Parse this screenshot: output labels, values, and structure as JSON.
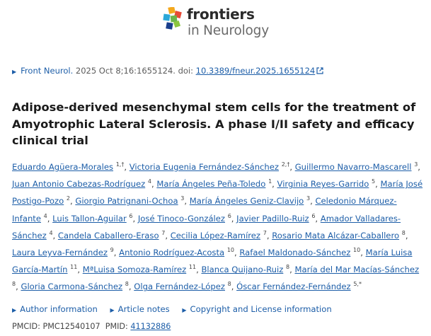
{
  "journal": {
    "brand": "frontiers",
    "name": "in Neurology"
  },
  "citation": {
    "journal_abbrev": "Front Neurol.",
    "details": " 2025 Oct 8;16:1655124. doi: ",
    "doi": "10.3389/fneur.2025.1655124"
  },
  "title": "Adipose-derived mesenchymal stem cells for the treatment of Amyotrophic Lateral Sclerosis. A phase I/II safety and efficacy clinical trial",
  "authors": [
    {
      "name": "Eduardo Agüera-Morales",
      "sup": "1,†"
    },
    {
      "name": "Victoria Eugenia Fernández-Sánchez",
      "sup": "2,†"
    },
    {
      "name": "Guillermo Navarro-Mascarell",
      "sup": "3"
    },
    {
      "name": "Juan Antonio Cabezas-Rodríguez",
      "sup": "4"
    },
    {
      "name": "María Ángeles Peña-Toledo",
      "sup": "1"
    },
    {
      "name": "Virginia Reyes-Garrido",
      "sup": "5"
    },
    {
      "name": "María José Postigo-Pozo",
      "sup": "2"
    },
    {
      "name": "Giorgio Patrignani-Ochoa",
      "sup": "3"
    },
    {
      "name": "María Ángeles Geniz-Clavijo",
      "sup": "3"
    },
    {
      "name": "Celedonio Márquez-Infante",
      "sup": "4"
    },
    {
      "name": "Luis Tallon-Aguilar",
      "sup": "6"
    },
    {
      "name": "José Tinoco-González",
      "sup": "6"
    },
    {
      "name": "Javier Padillo-Ruiz",
      "sup": "6"
    },
    {
      "name": "Amador Valladares-Sánchez",
      "sup": "4"
    },
    {
      "name": "Candela Caballero-Eraso",
      "sup": "7"
    },
    {
      "name": "Cecilia López-Ramírez",
      "sup": "7"
    },
    {
      "name": "Rosario Mata Alcázar-Caballero",
      "sup": "8"
    },
    {
      "name": "Laura Leyva-Fernández",
      "sup": "9"
    },
    {
      "name": "Antonio Rodríguez-Acosta",
      "sup": "10"
    },
    {
      "name": "Rafael Maldonado-Sánchez",
      "sup": "10"
    },
    {
      "name": "María Luisa García-Martín",
      "sup": "11"
    },
    {
      "name": "MªLuisa Somoza-Ramírez",
      "sup": "11"
    },
    {
      "name": "Blanca Quijano-Ruiz",
      "sup": "8"
    },
    {
      "name": "María del Mar Macías-Sánchez",
      "sup": "8"
    },
    {
      "name": "Gloria Carmona-Sánchez",
      "sup": "8"
    },
    {
      "name": "Olga Fernández-López",
      "sup": "8"
    },
    {
      "name": "Óscar Fernández-Fernández",
      "sup": "5,*"
    }
  ],
  "links": {
    "author_info": "Author information",
    "article_notes": "Article notes",
    "copyright": "Copyright and License information"
  },
  "ids": {
    "pmcid_label": "PMCID: ",
    "pmcid": "PMC12540107",
    "pmid_label": "PMID: ",
    "pmid": "41132886"
  },
  "colors": {
    "link": "#1d5ea8",
    "text": "#1b1b1b"
  }
}
